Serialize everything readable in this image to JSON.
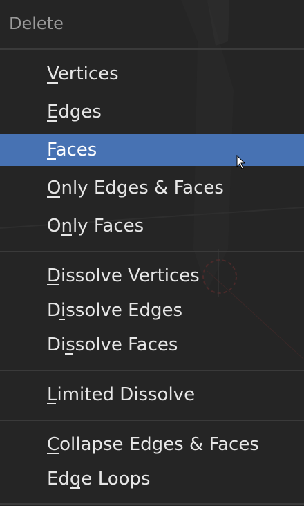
{
  "menu": {
    "title": "Delete",
    "items": [
      {
        "label": "Vertices",
        "active": false
      },
      {
        "label": "Edges",
        "active": false
      },
      {
        "label": "Faces",
        "active": true
      },
      {
        "label": "Only Edges & Faces",
        "active": false
      },
      {
        "label": "Only Faces",
        "active": false
      },
      {
        "label": "Dissolve Vertices",
        "active": false
      },
      {
        "label": "Dissolve Edges",
        "active": false
      },
      {
        "label": "Dissolve Faces",
        "active": false
      },
      {
        "label": "Limited Dissolve",
        "active": false
      },
      {
        "label": "Collapse Edges & Faces",
        "active": false
      },
      {
        "label": "Edge Loops",
        "active": false
      }
    ]
  },
  "colors": {
    "menu_background": "#252525",
    "highlight": "#4772b3",
    "text": "#e6e6e6",
    "title_text": "#9a9a9a",
    "separator": "#3a3a3a"
  },
  "icons": {
    "cursor": "mouse-pointer-icon"
  }
}
